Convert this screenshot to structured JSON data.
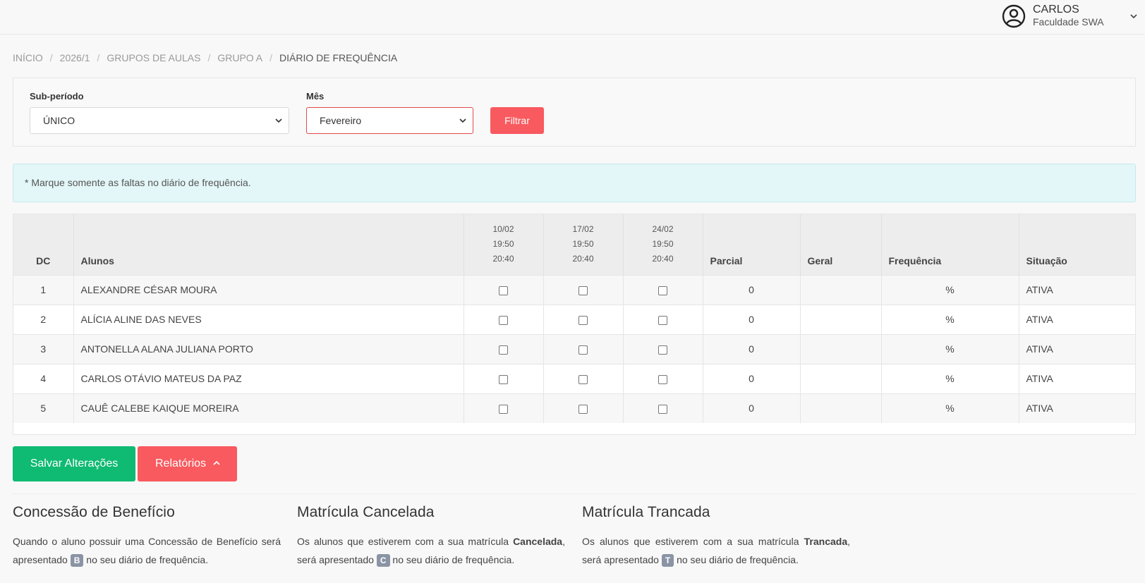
{
  "user": {
    "name": "CARLOS",
    "org": "Faculdade SWA",
    "icon": "user-circle-icon"
  },
  "breadcrumb": [
    "INÍCIO",
    "2026/1",
    "GRUPOS DE AULAS",
    "GRUPO A",
    "DIÁRIO DE FREQUÊNCIA"
  ],
  "filters": {
    "subperiodo_label": "Sub-período",
    "subperiodo_value": "ÚNICO",
    "mes_label": "Mês",
    "mes_value": "Fevereiro",
    "filtrar_label": "Filtrar"
  },
  "alert": "* Marque somente as faltas no diário de frequência.",
  "table": {
    "headers": {
      "dc": "DC",
      "alunos": "Alunos",
      "parcial": "Parcial",
      "geral": "Geral",
      "frequencia": "Frequência",
      "situacao": "Situação"
    },
    "dates": [
      {
        "date": "10/02",
        "start": "19:50",
        "end": "20:40"
      },
      {
        "date": "17/02",
        "start": "19:50",
        "end": "20:40"
      },
      {
        "date": "24/02",
        "start": "19:50",
        "end": "20:40"
      }
    ],
    "rows": [
      {
        "dc": "1",
        "name": "ALEXANDRE CÉSAR MOURA",
        "parcial": "0",
        "geral": "",
        "frequencia": "%",
        "situacao": "ATIVA"
      },
      {
        "dc": "2",
        "name": "ALÍCIA ALINE DAS NEVES",
        "parcial": "0",
        "geral": "",
        "frequencia": "%",
        "situacao": "ATIVA"
      },
      {
        "dc": "3",
        "name": "ANTONELLA ALANA JULIANA PORTO",
        "parcial": "0",
        "geral": "",
        "frequencia": "%",
        "situacao": "ATIVA"
      },
      {
        "dc": "4",
        "name": "CARLOS OTÁVIO MATEUS DA PAZ",
        "parcial": "0",
        "geral": "",
        "frequencia": "%",
        "situacao": "ATIVA"
      },
      {
        "dc": "5",
        "name": "CAUÊ CALEBE KAIQUE MOREIRA",
        "parcial": "0",
        "geral": "",
        "frequencia": "%",
        "situacao": "ATIVA"
      }
    ]
  },
  "actions": {
    "salvar": "Salvar Alterações",
    "relatorios": "Relatórios"
  },
  "legend": [
    {
      "title": "Concessão de Benefício",
      "text_before": "Quando o aluno possuir uma Concessão de Benefício será apresentado",
      "bold": "",
      "badge": "B",
      "text_after": "no seu diário de frequência."
    },
    {
      "title": "Matrícula Cancelada",
      "text_before": "Os alunos que estiverem com a sua matrícula",
      "bold": "Cancelada",
      "text_mid": ", será apresentado",
      "badge": "C",
      "text_after": "no seu diário de frequência."
    },
    {
      "title": "Matrícula Trancada",
      "text_before": "Os alunos que estiverem com a sua matrícula",
      "bold": "Trancada",
      "text_mid": ", será apresentado",
      "badge": "T",
      "text_after": "no seu diário de frequência."
    }
  ],
  "colors": {
    "primary_red": "#f85a5f",
    "success_green": "#0fba73",
    "alert_bg": "#e3f6f8",
    "badge_gray": "#8a94a4"
  }
}
